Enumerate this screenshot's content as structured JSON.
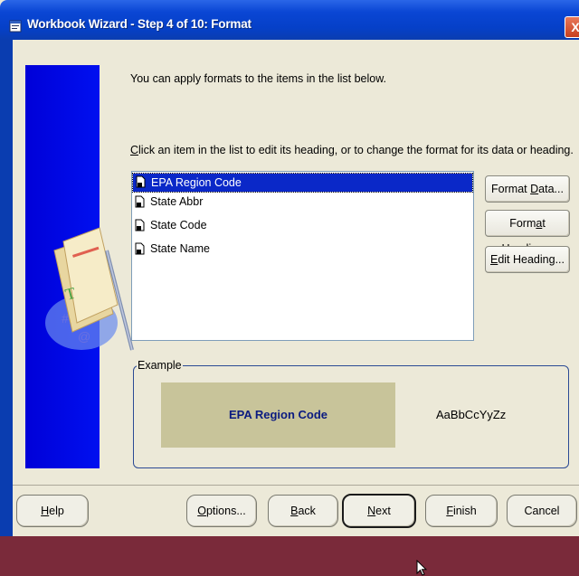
{
  "window": {
    "title": "Workbook Wizard - Step 4 of 10: Format",
    "close_glyph": "X"
  },
  "intro_text": "You can apply formats to the items in the list below.",
  "instructions": "lick an item in the list to edit its heading, or to change the format for its data or heading.",
  "instructions_mnemonic": "C",
  "items": [
    {
      "label": "EPA Region Code",
      "selected": true
    },
    {
      "label": "State Abbr",
      "selected": false
    },
    {
      "label": "State Code",
      "selected": false
    },
    {
      "label": "State Name",
      "selected": false
    }
  ],
  "side_buttons": {
    "format_data": {
      "pre": "Format ",
      "mn": "D",
      "post": "ata..."
    },
    "format_heading": {
      "pre": "Form",
      "mn": "a",
      "post": "t Heading..."
    },
    "edit_heading": {
      "pre": "",
      "mn": "E",
      "post": "dit Heading..."
    }
  },
  "example": {
    "legend": "Example",
    "heading_sample": "EPA Region Code",
    "data_sample": "AaBbCcYyZz"
  },
  "bottom_buttons": {
    "help": {
      "pre": "",
      "mn": "H",
      "post": "elp"
    },
    "options": {
      "pre": "",
      "mn": "O",
      "post": "ptions..."
    },
    "back": {
      "pre": "",
      "mn": "B",
      "post": "ack"
    },
    "next": {
      "pre": "",
      "mn": "N",
      "post": "ext"
    },
    "finish": {
      "pre": "",
      "mn": "F",
      "post": "inish"
    },
    "cancel": {
      "pre": "Cancel",
      "mn": "",
      "post": ""
    }
  },
  "colors": {
    "titlebar": "#0540c8",
    "selection": "#0a28c8",
    "heading_bg": "#c8c49a",
    "heading_text": "#0a1a80"
  },
  "icons": [
    "app-icon",
    "close-icon",
    "field-item-icon",
    "wizard-art-icon",
    "mouse-cursor-icon"
  ]
}
